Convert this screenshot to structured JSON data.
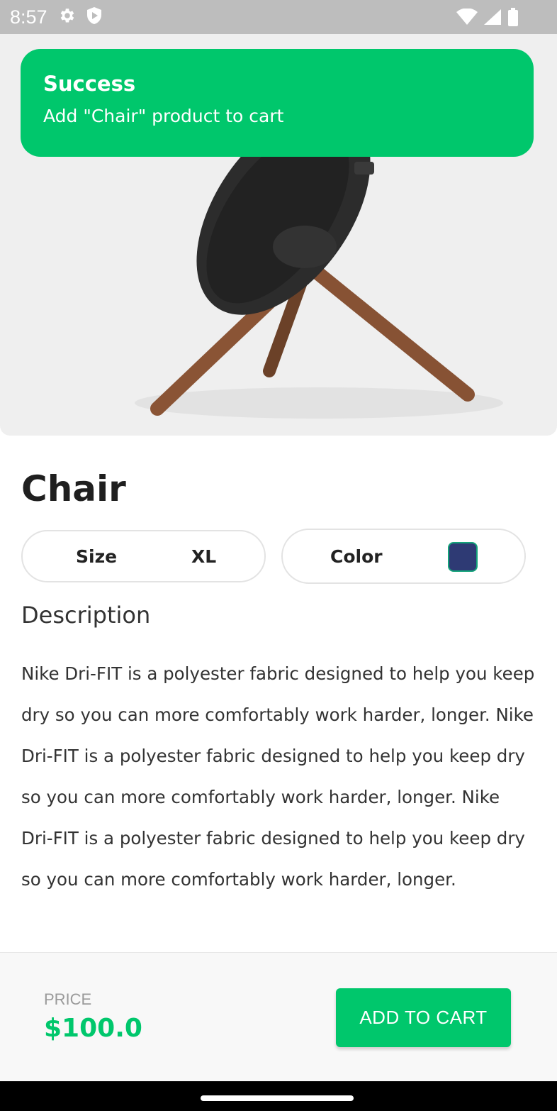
{
  "status_bar": {
    "time": "8:57",
    "icons": [
      "settings-icon",
      "shield-icon",
      "wifi-icon",
      "signal-icon",
      "battery-icon"
    ]
  },
  "toast": {
    "title": "Success",
    "message": "Add \"Chair\" product to cart"
  },
  "product": {
    "name": "Chair",
    "size_label": "Size",
    "size_value": "XL",
    "color_label": "Color",
    "color_value": "#2e3a74",
    "description_heading": "Description",
    "description": "Nike Dri-FIT is a polyester fabric designed to help you keep dry so you can more comfortably work harder, longer. Nike Dri-FIT is a polyester fabric designed to help you keep dry so you can more comfortably work harder, longer. Nike Dri-FIT is a polyester fabric designed to help you keep dry so you can more comfortably work harder, longer."
  },
  "footer": {
    "price_label": "PRICE",
    "price_value": "$100.0",
    "add_to_cart_label": "ADD TO CART"
  },
  "colors": {
    "accent": "#00c76c",
    "swatch": "#2e3a74"
  }
}
